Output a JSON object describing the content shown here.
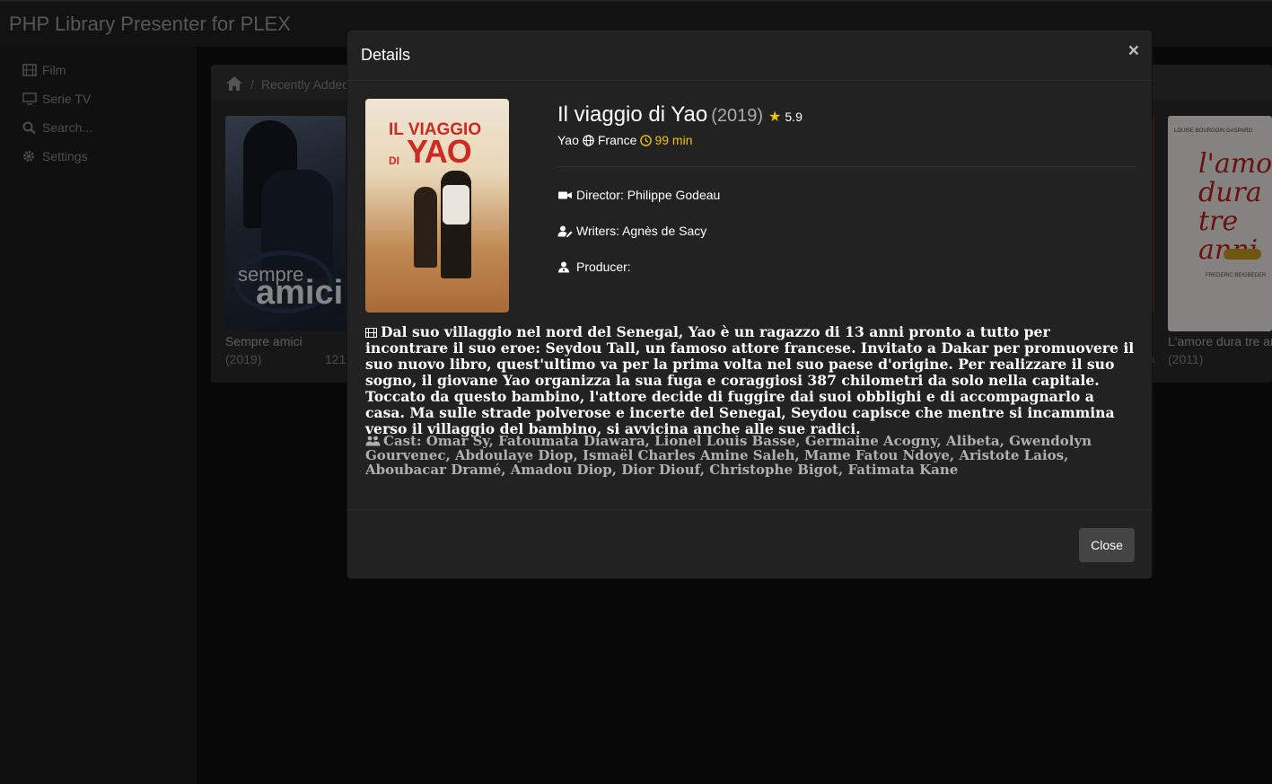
{
  "app": {
    "title": "PHP Library Presenter for PLEX"
  },
  "sidebar": {
    "items": [
      {
        "label": "Film",
        "icon": "film-icon"
      },
      {
        "label": "Serie TV",
        "icon": "tv-icon"
      },
      {
        "label": "Search...",
        "icon": "search-icon"
      },
      {
        "label": "Settings",
        "icon": "gear-icon"
      }
    ]
  },
  "breadcrumb": {
    "home_icon": "home-icon",
    "separator": "/",
    "current": "Recently Added"
  },
  "grid": {
    "items": [
      {
        "poster_text_1": "sempre",
        "poster_text_2": "amici",
        "title": "Sempre amici",
        "year": "(2019)",
        "duration": "121"
      },
      {
        "poster_names": "LOUISE BOURGOIN   GASPARD",
        "poster_script": "l'amore dura tre anni",
        "poster_small": "FREDERIC BEIGBEDER",
        "title": "L'amore dura tre anni",
        "year": "(2011)",
        "edge_text": "a"
      }
    ]
  },
  "modal": {
    "header": "Details",
    "close_glyph": "×",
    "cover": {
      "line1": "IL VIAGGIO",
      "line2": "DI",
      "line3": "YAO"
    },
    "title": "Il viaggio di Yao",
    "year": "(2019)",
    "rating": "5.9",
    "original_title": "Yao",
    "country": "France",
    "duration": "99 min",
    "director": "Director: Philippe Godeau",
    "writers": "Writers: Agnès de Sacy",
    "producer": "Producer:",
    "plot": "Dal suo villaggio nel nord del Senegal, Yao è un ragazzo di 13 anni pronto a tutto per incontrare il suo eroe: Seydou Tall, un famoso attore francese. Invitato a Dakar per promuovere il suo nuovo libro, quest'ultimo va per la prima volta nel suo paese d'origine. Per realizzare il suo sogno, il giovane Yao organizza la sua fuga e coraggiosi 387 chilometri da solo nella capitale. Toccato da questo bambino, l'attore decide di fuggire dai suoi obblighi e di accompagnarlo a casa. Ma sulle strade polverose e incerte del Senegal, Seydou capisce che mentre si incammina verso il villaggio del bambino, si avvicina anche alle sue radici.",
    "cast": "Cast: Omar Sy, Fatoumata Diawara, Lionel Louis Basse, Germaine Acogny, Alibeta, Gwendolyn Gourvenec, Abdoulaye Diop, Ismaël Charles Amine Saleh, Mame Fatou Ndoye, Aristote Laios, Aboubacar Dramé, Amadou Diop, Dior Diouf, Christophe Bigot, Fatimata Kane",
    "close_label": "Close"
  },
  "colors": {
    "accent": "#f0c000",
    "modal_bg": "#222222",
    "button_bg": "#444444"
  }
}
